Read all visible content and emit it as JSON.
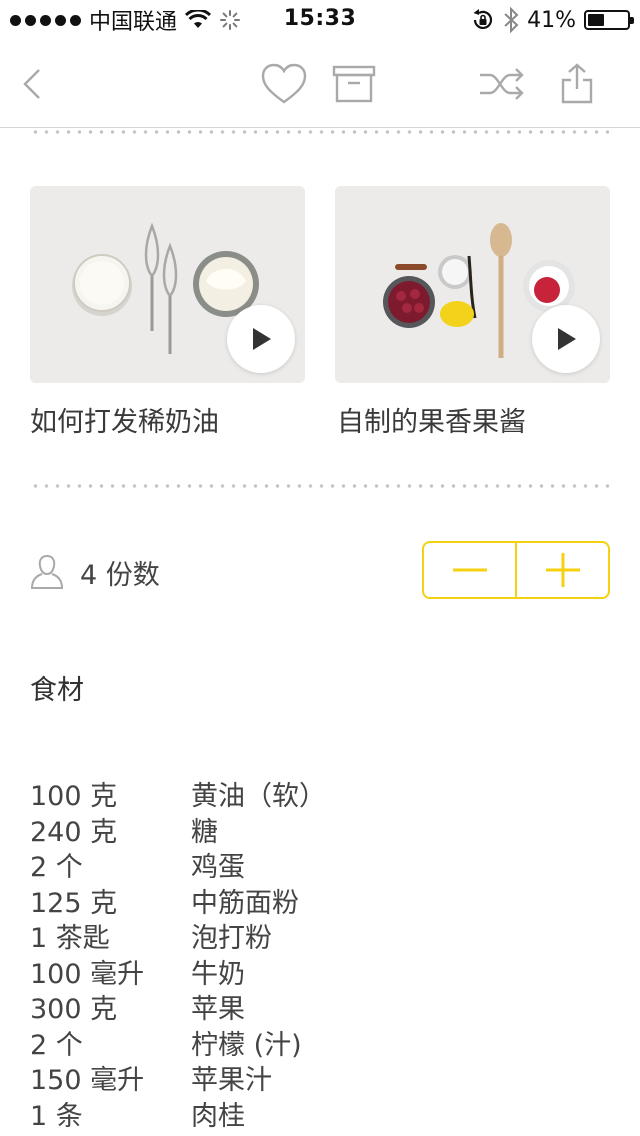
{
  "status_bar": {
    "carrier": "中国联通",
    "time": "15:33",
    "battery_text": "41%",
    "battery_level": 0.41
  },
  "nav": {
    "icons": [
      "back-chevron-icon",
      "heart-icon",
      "archive-box-icon",
      "shuffle-icon",
      "share-icon"
    ]
  },
  "videos": [
    {
      "title": "如何打发稀奶油"
    },
    {
      "title": "自制的果香果酱"
    }
  ],
  "servings": {
    "text": "4 份数",
    "minus_label": "−",
    "plus_label": "+"
  },
  "ingredients": {
    "heading": "食材",
    "items": [
      {
        "amount": "100 克",
        "name": "黄油（软）"
      },
      {
        "amount": "240 克",
        "name": "糖"
      },
      {
        "amount": "2 个",
        "name": "鸡蛋"
      },
      {
        "amount": "125 克",
        "name": "中筋面粉"
      },
      {
        "amount": "1 茶匙",
        "name": "泡打粉"
      },
      {
        "amount": "100 毫升",
        "name": "牛奶"
      },
      {
        "amount": "300 克",
        "name": "苹果"
      },
      {
        "amount": "2 个",
        "name": "柠檬 (汁)"
      },
      {
        "amount": "150 毫升",
        "name": "苹果汁"
      },
      {
        "amount": "1 条",
        "name": "肉桂"
      }
    ]
  },
  "colors": {
    "accent": "#f5d10f",
    "icon_gray": "#a9a9a9",
    "text": "#333333"
  }
}
